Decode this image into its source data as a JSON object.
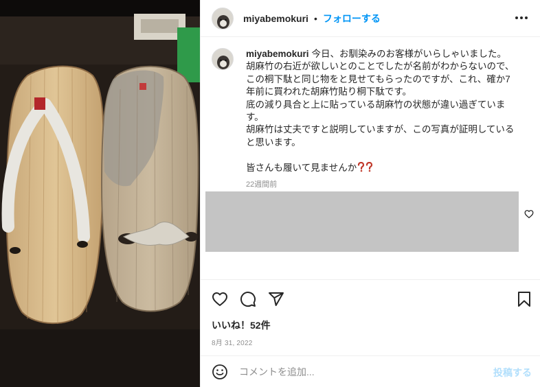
{
  "post": {
    "username": "miyabemokuri",
    "dot": "•",
    "follow_label": "フォローする",
    "icons": {
      "more": "more-horizontal-icon",
      "like": "heart-icon",
      "comment": "comment-bubble-icon",
      "share": "paper-plane-icon",
      "save": "bookmark-icon",
      "emoji": "smiley-icon"
    }
  },
  "caption": {
    "username": "miyabemokuri",
    "lines": [
      "今日、お馴染みのお客様がいらしゃいました。",
      "胡麻竹の右近が欲しいとのことでしたが名前がわからないので、この桐下駄と同じ物をと見せてもらったのですが、これ、確か7年前に買われた胡麻竹貼り桐下駄です。",
      "底の減り具合と上に貼っている胡麻竹の状態が違い過ぎています。",
      "胡麻竹は丈夫ですと説明していますが、この写真が証明していると思います。",
      "",
      "皆さんも履いて見ませんか"
    ],
    "emoji": "❓❓",
    "time_ago": "22週間前"
  },
  "likes_text": "いいね！52件",
  "date_text": "8月 31, 2022",
  "comment_box": {
    "placeholder": "コメントを追加...",
    "post_label": "投稿する"
  },
  "colors": {
    "accent": "#0095f6",
    "post_disabled": "#b2dffc",
    "muted": "#8e8e8e",
    "placeholder_box": "#c4c4c4",
    "question_mark": "#c0392b"
  }
}
